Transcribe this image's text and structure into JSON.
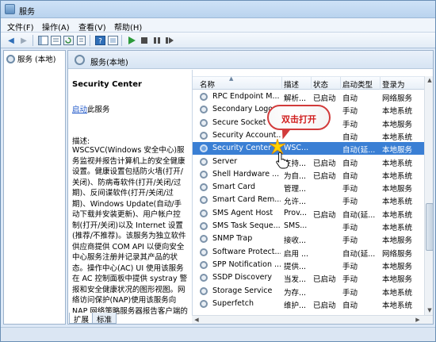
{
  "window": {
    "title": "服务"
  },
  "menu": [
    {
      "label": "文件(F)"
    },
    {
      "label": "操作(A)"
    },
    {
      "label": "查看(V)"
    },
    {
      "label": "帮助(H)"
    }
  ],
  "toolbar": {
    "icons": [
      "back-icon",
      "forward-icon",
      "show-tree-icon",
      "list-icon",
      "refresh-icon",
      "export-icon",
      "help-icon",
      "properties-icon",
      "play-icon",
      "stop-icon",
      "pause-icon",
      "restart-icon"
    ]
  },
  "tree": {
    "root_label": "服务 (本地)"
  },
  "main": {
    "header_title": "服务(本地)"
  },
  "description": {
    "service_title": "Security Center",
    "start_link": "启动",
    "start_suffix": "此服务",
    "label": "描述:",
    "text": "WSCSVC(Windows 安全中心)服务监视并报告计算机上的安全健康设置。健康设置包括防火墙(打开/关闭)、防病毒软件(打开/关闭/过期)、反间谍软件(打开/关闭/过期)、Windows Update(自动/手动下载并安装更新)、用户帐户控制(打开/关闭)以及 Internet 设置(推荐/不推荐)。该服务为独立软件供应商提供 COM API 以便向安全中心服务注册并记录其产品的状态。操作中心(AC) UI 使用该服务在 AC 控制面板中提供 systray 警报和安全健康状况的图形视图。网络访问保护(NAP)使用该服务向 NAP 网络策略服务器报告客户端的"
  },
  "columns": {
    "name": "名称",
    "desc": "描述",
    "status": "状态",
    "start_type": "启动类型",
    "logon": "登录为"
  },
  "rows": [
    {
      "name": "RPC Endpoint M...",
      "desc": "解析...",
      "status": "已启动",
      "start_type": "自动",
      "logon": "网络服务"
    },
    {
      "name": "Secondary Logo...",
      "desc": "",
      "status": "",
      "start_type": "手动",
      "logon": "本地系统"
    },
    {
      "name": "Secure Socket ...",
      "desc": "",
      "status": "",
      "start_type": "手动",
      "logon": "本地服务"
    },
    {
      "name": "Security Account...",
      "desc": "",
      "status": "",
      "start_type": "自动",
      "logon": "本地系统"
    },
    {
      "name": "Security Center",
      "desc": "WSC...",
      "status": "",
      "start_type": "自动(延...",
      "logon": "本地服务",
      "selected": true
    },
    {
      "name": "Server",
      "desc": "支持...",
      "status": "已启动",
      "start_type": "自动",
      "logon": "本地系统"
    },
    {
      "name": "Shell Hardware ...",
      "desc": "为自...",
      "status": "已启动",
      "start_type": "自动",
      "logon": "本地系统"
    },
    {
      "name": "Smart Card",
      "desc": "管理...",
      "status": "",
      "start_type": "手动",
      "logon": "本地服务"
    },
    {
      "name": "Smart Card Rem...",
      "desc": "允许...",
      "status": "",
      "start_type": "手动",
      "logon": "本地系统"
    },
    {
      "name": "SMS Agent Host",
      "desc": "Prov...",
      "status": "已启动",
      "start_type": "自动(延...",
      "logon": "本地系统"
    },
    {
      "name": "SMS Task Seque...",
      "desc": "SMS...",
      "status": "",
      "start_type": "手动",
      "logon": "本地系统"
    },
    {
      "name": "SNMP Trap",
      "desc": "接收...",
      "status": "",
      "start_type": "手动",
      "logon": "本地服务"
    },
    {
      "name": "Software Protect...",
      "desc": "启用 ...",
      "status": "",
      "start_type": "自动(延...",
      "logon": "网络服务"
    },
    {
      "name": "SPP Notification ...",
      "desc": "提供...",
      "status": "",
      "start_type": "手动",
      "logon": "本地服务"
    },
    {
      "name": "SSDP Discovery",
      "desc": "当发...",
      "status": "已启动",
      "start_type": "手动",
      "logon": "本地服务"
    },
    {
      "name": "Storage Service",
      "desc": "为存...",
      "status": "",
      "start_type": "手动",
      "logon": "本地系统"
    },
    {
      "name": "Superfetch",
      "desc": "维护...",
      "status": "已启动",
      "start_type": "自动",
      "logon": "本地系统"
    }
  ],
  "tabs": [
    {
      "label": "扩展",
      "active": true
    },
    {
      "label": "标准",
      "active": false
    }
  ],
  "callout": {
    "text": "双击打开"
  },
  "colors": {
    "selection": "#3a7fd4",
    "callout_border": "#d23b3b",
    "callout_text": "#d01d1d",
    "link": "#1e56c8"
  }
}
